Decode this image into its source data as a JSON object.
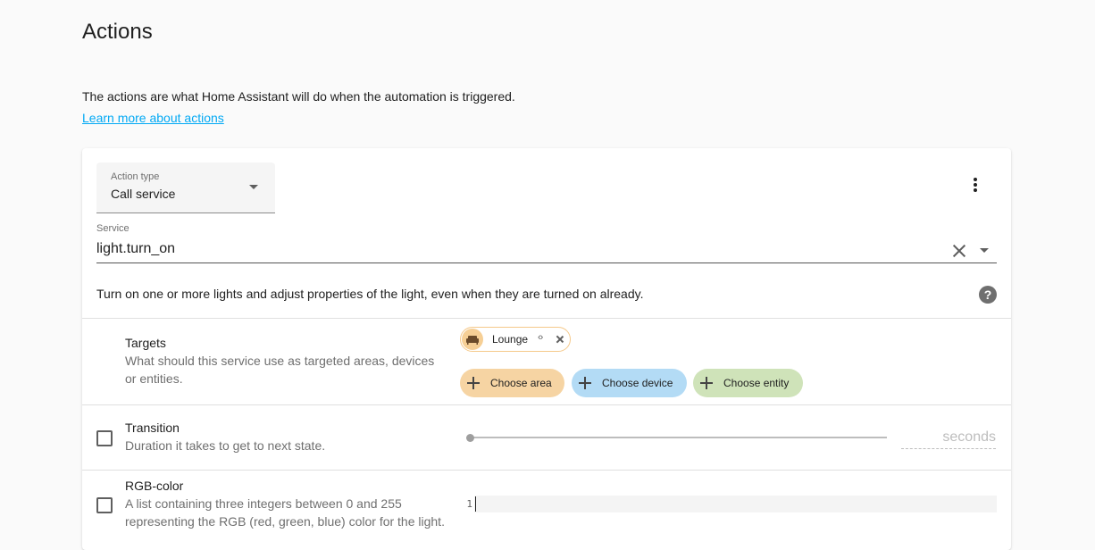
{
  "page": {
    "title": "Actions",
    "description": "The actions are what Home Assistant will do when the automation is triggered.",
    "learn_more": "Learn more about actions"
  },
  "action": {
    "type_label": "Action type",
    "type_value": "Call service",
    "service_label": "Service",
    "service_value": "light.turn_on",
    "service_description": "Turn on one or more lights and adjust properties of the light, even when they are turned on already.",
    "help_symbol": "?"
  },
  "targets": {
    "title": "Targets",
    "description_line1": "What should this service use as targeted areas, devices",
    "description_line2": "or entities.",
    "selected": [
      {
        "label": "Lounge",
        "icon": "sofa-icon"
      }
    ],
    "expand_symbol": "‹›",
    "choose_area": "Choose area",
    "choose_device": "Choose device",
    "choose_entity": "Choose entity"
  },
  "transition": {
    "title": "Transition",
    "description": "Duration it takes to get to next state.",
    "suffix": "seconds",
    "checked": false,
    "slider_value": 0
  },
  "rgb_color": {
    "title": "RGB-color",
    "description_line1": "A list containing three integers between 0 and 255",
    "description_line2": "representing the RGB (red, green, blue) color for the light.",
    "line_number": "1",
    "checked": false
  },
  "colors": {
    "link": "#03a9f4",
    "area_chip": "#f6d4a3",
    "device_chip": "#b3dbf5",
    "entity_chip": "#cfe3b9",
    "selected_chip_border": "#f5c98a"
  }
}
